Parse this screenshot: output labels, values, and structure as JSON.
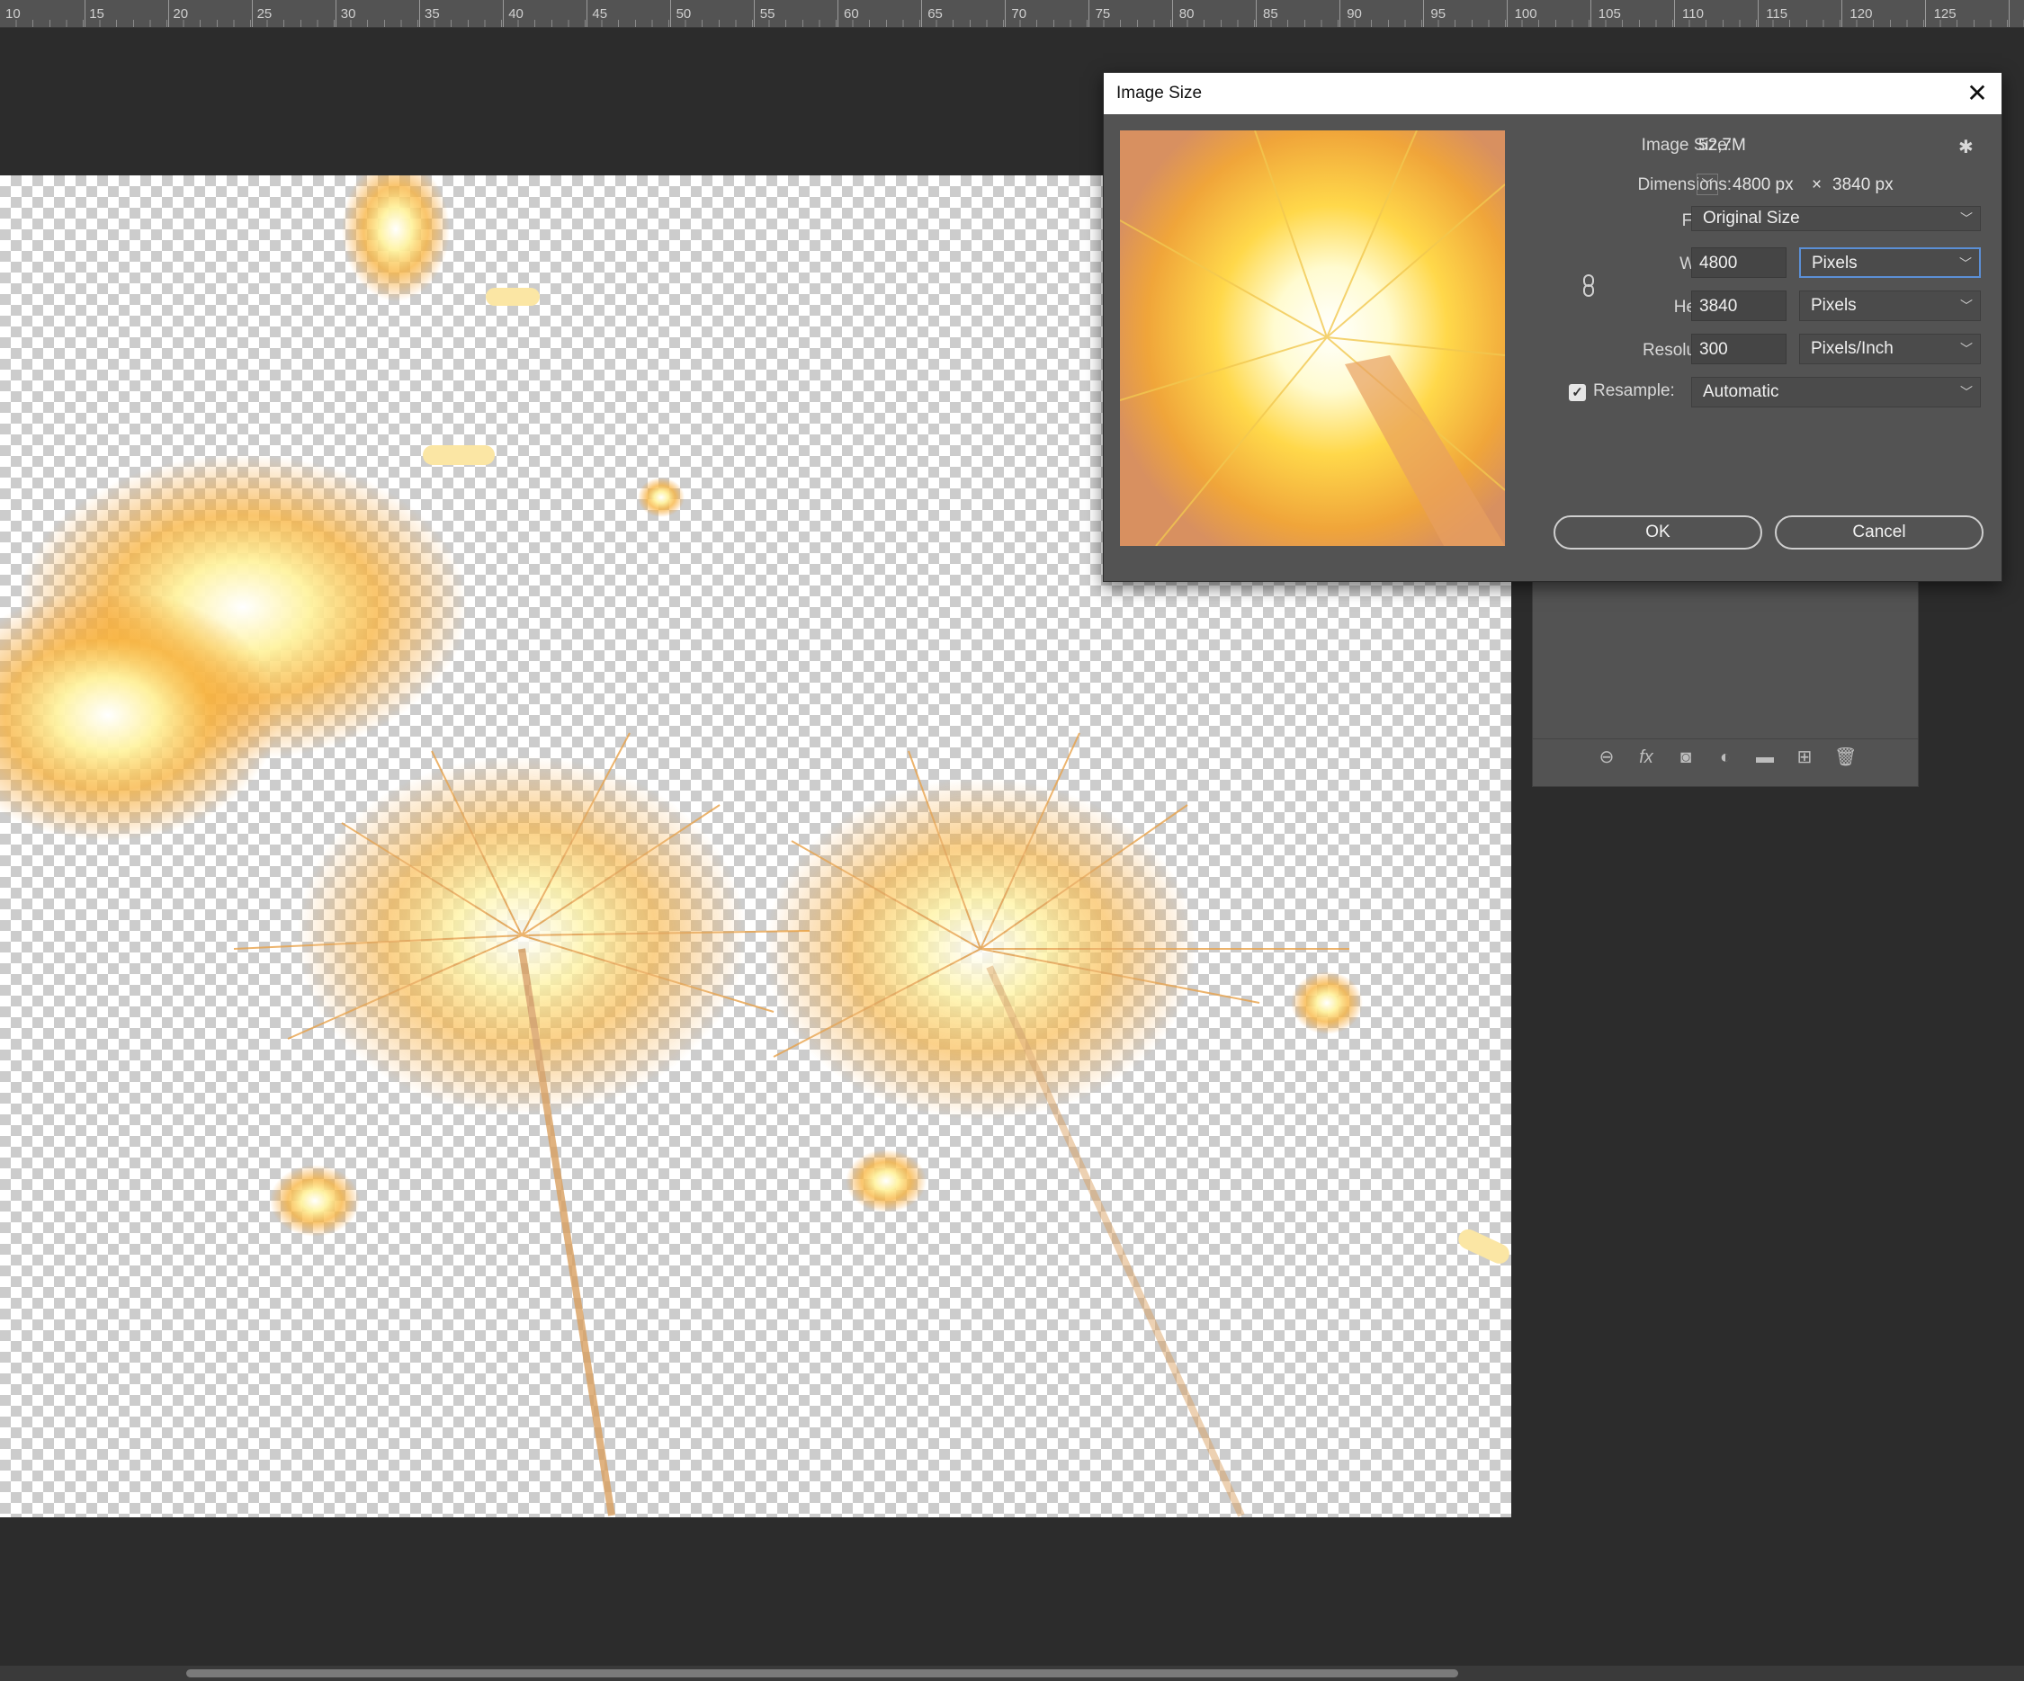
{
  "ruler": {
    "ticks": [
      "10",
      "15",
      "20",
      "25",
      "30",
      "35",
      "40",
      "45",
      "50",
      "55",
      "60",
      "65",
      "70",
      "75",
      "80",
      "85",
      "90",
      "95",
      "100",
      "105",
      "110",
      "115",
      "120",
      "125"
    ]
  },
  "dialog": {
    "title": "Image Size",
    "close_icon": "close-icon",
    "settings_icon": "gear-icon",
    "image_size_label": "Image Size:",
    "image_size_value": "52,7M",
    "dimensions_label": "Dimensions:",
    "dimensions_width": "4800 px",
    "dimensions_times": "×",
    "dimensions_height": "3840 px",
    "fit_to_label": "Fit To:",
    "fit_to_value": "Original Size",
    "width_label": "Width:",
    "width_value": "4800",
    "width_unit": "Pixels",
    "height_label": "Height:",
    "height_value": "3840",
    "height_unit": "Pixels",
    "resolution_label": "Resolution:",
    "resolution_value": "300",
    "resolution_unit": "Pixels/Inch",
    "resample_label": "Resample:",
    "resample_checked": true,
    "resample_value": "Automatic",
    "ok_label": "OK",
    "cancel_label": "Cancel",
    "link_icon": "chain-link-icon"
  },
  "layers_footer_icons": [
    "link-layers-icon",
    "fx-icon",
    "layer-mask-icon",
    "adjustment-layer-icon",
    "folder-icon",
    "new-layer-icon",
    "trash-icon"
  ],
  "layers_footer_fx": "fx"
}
